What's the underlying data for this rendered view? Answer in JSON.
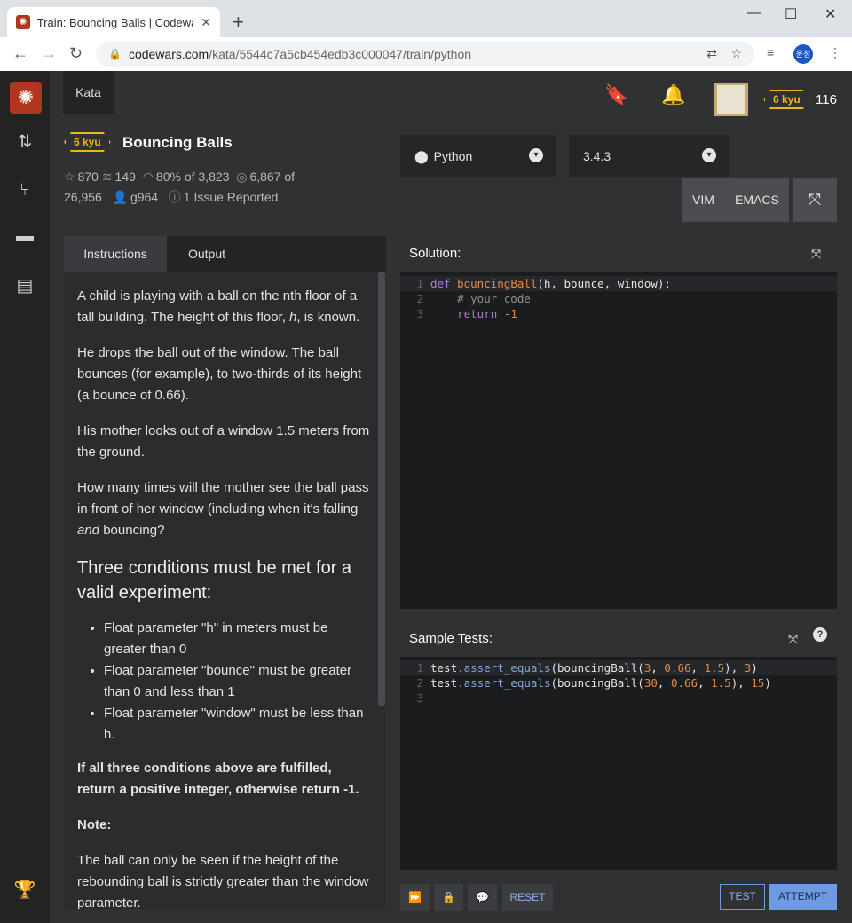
{
  "browser": {
    "tab_title": "Train: Bouncing Balls | Codewars",
    "url_host": "codewars.com",
    "url_path": "/kata/5544c7a5cb454edb3c000047/train/python",
    "profile_initials": "윤정"
  },
  "header": {
    "kata_button": "Kata",
    "user_rank": "6 kyu",
    "honor": "116"
  },
  "kata": {
    "rank": "6 kyu",
    "title": "Bouncing Balls",
    "stars": "870",
    "collections": "149",
    "satisfaction": "80%",
    "satisfaction_of": "of 3,823",
    "completed": "6,867",
    "completed_of": "of",
    "attempts": "26,956",
    "author": "g964",
    "issues": "1 Issue Reported"
  },
  "language": {
    "label": "Python",
    "version": "3.4.3"
  },
  "modes": {
    "vim": "VIM",
    "emacs": "EMACS"
  },
  "tabs": {
    "instructions": "Instructions",
    "output": "Output"
  },
  "description": {
    "p1a": "A child is playing with a ball on the nth floor of a tall building. The height of this floor, ",
    "p1h": "h",
    "p1b": ", is known.",
    "p2": "He drops the ball out of the window. The ball bounces (for example), to two-thirds of its height (a bounce of 0.66).",
    "p3": "His mother looks out of a window 1.5 meters from the ground.",
    "p4a": "How many times will the mother see the ball pass in front of her window (including when it's falling ",
    "p4and": "and",
    "p4b": " bouncing?",
    "h_conditions": "Three conditions must be met for a valid experiment:",
    "cond1": "Float parameter \"h\" in meters must be greater than 0",
    "cond2": "Float parameter \"bounce\" must be greater than 0 and less than 1",
    "cond3": "Float parameter \"window\" must be less than h.",
    "p5": "If all three conditions above are fulfilled, return a positive integer, otherwise return -1.",
    "note": "Note:",
    "p6": "The ball can only be seen if the height of the rebounding ball is strictly greater than the window parameter."
  },
  "solution": {
    "header": "Solution:",
    "lines": [
      "1",
      "2",
      "3"
    ],
    "code_def": "def",
    "code_fn": "bouncingBall",
    "code_args": "(h, bounce, window):",
    "code_comment": "    # your code",
    "code_return": "    return ",
    "code_val": "-1"
  },
  "tests": {
    "header": "Sample Tests:",
    "lines": [
      "1",
      "2",
      "3"
    ],
    "l1_a": "test",
    "l1_m": ".assert_equals",
    "l1_b": "(bouncingBall(",
    "l1_n1": "3",
    "l1_n2": "0.66",
    "l1_n3": "1.5",
    "l1_r": "3",
    "l2_n1": "30",
    "l2_n2": "0.66",
    "l2_n3": "1.5",
    "l2_r": "15",
    "comma": ", ",
    "close_mid": "), ",
    "close_end": ")"
  },
  "footer": {
    "reset": "RESET",
    "test": "TEST",
    "attempt": "ATTEMPT"
  },
  "colors": {
    "accent": "#6d9ae0",
    "rank_yellow": "#ecb613",
    "brand_red": "#b1361e"
  }
}
